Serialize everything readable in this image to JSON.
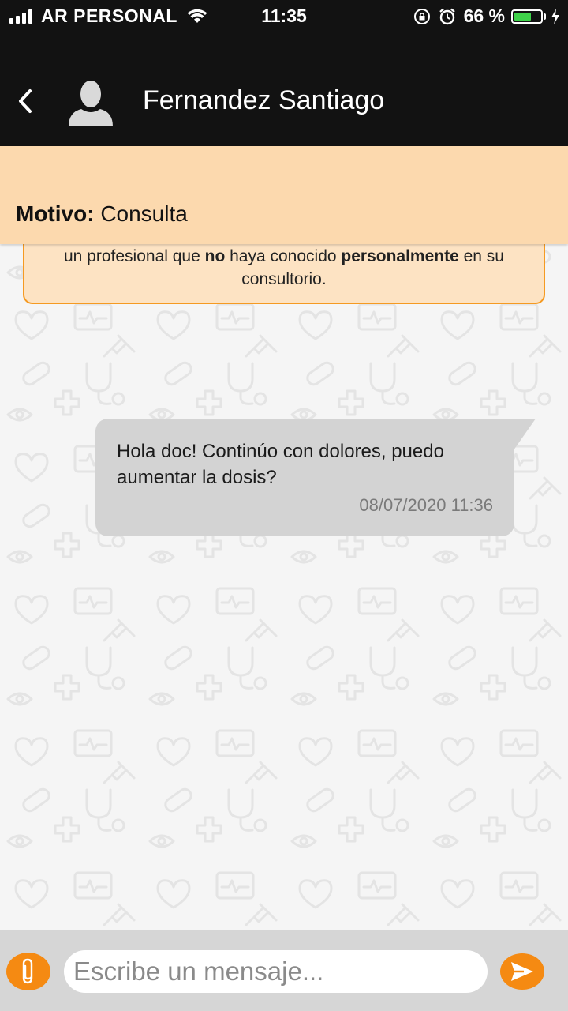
{
  "status_bar": {
    "carrier": "AR PERSONAL",
    "time": "11:35",
    "battery_percent": "66 %",
    "battery_level": 0.66,
    "battery_color": "#3fd34a",
    "icons": [
      "signal-icon",
      "wifi-icon",
      "orientation-lock-icon",
      "alarm-icon",
      "battery-icon",
      "charging-bolt-icon"
    ]
  },
  "header": {
    "contact_name": "Fernandez Santiago",
    "back_icon": "chevron-left-icon",
    "avatar_icon": "person-placeholder-icon"
  },
  "motive": {
    "label": "Motivo:",
    "value": "Consulta"
  },
  "notice": {
    "part1": "un profesional que ",
    "bold1": "no",
    "part2": " haya conocido ",
    "bold2": "personalmente",
    "part3": " en su consultorio."
  },
  "messages": [
    {
      "text": "Hola doc! Continúo con dolores, puedo aumentar la dosis?",
      "timestamp": "08/07/2020 11:36"
    }
  ],
  "composer": {
    "placeholder": "Escribe un mensaje...",
    "attach_icon": "paperclip-icon",
    "send_icon": "send-icon"
  },
  "colors": {
    "accent": "#f58a12",
    "header_bg": "#121212",
    "banner_bg": "#fcd9ae",
    "notice_border": "#f59a22",
    "bubble_bg": "#d3d3d3"
  }
}
